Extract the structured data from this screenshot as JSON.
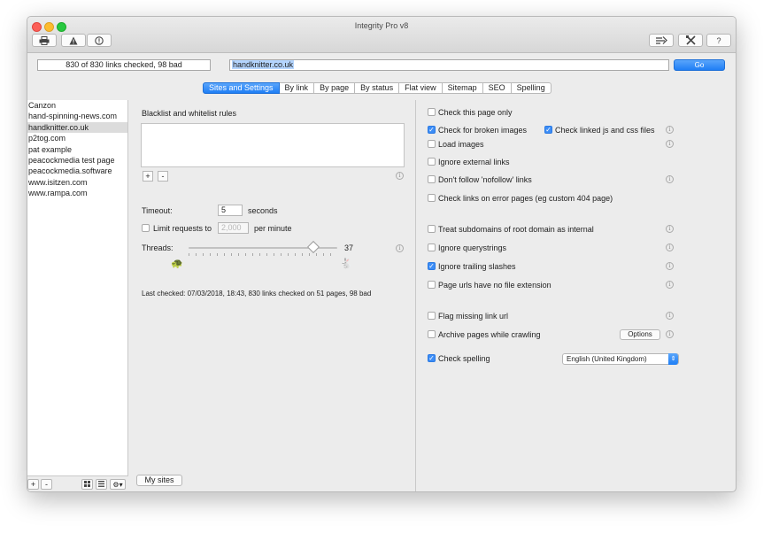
{
  "window": {
    "title": "Integrity Pro v8"
  },
  "toolbar": {
    "print_icon": "printer-icon",
    "warning_icon": "warning-icon",
    "info_icon": "info-icon",
    "filter_icon": "filter-icon",
    "tools_icon": "tools-icon",
    "help_label": "?"
  },
  "status": {
    "link_count": "830 of 830 links checked, 98 bad"
  },
  "url": {
    "value": "handknitter.co.uk",
    "go_label": "Go"
  },
  "tabs": [
    "Sites and Settings",
    "By link",
    "By page",
    "By status",
    "Flat view",
    "Sitemap",
    "SEO",
    "Spelling"
  ],
  "sidebar": {
    "sites": [
      "Canzon",
      "hand-spinning-news.com",
      "handknitter.co.uk",
      "p2tog.com",
      "pat example",
      "peacockmedia test page",
      "peacockmedia.software",
      "www.isitzen.com",
      "www.rampa.com"
    ],
    "selected_index": 2,
    "add_label": "+",
    "remove_label": "-",
    "my_sites_label": "My sites"
  },
  "left_panel": {
    "rules_heading": "Blacklist and whitelist rules",
    "rule_add": "+",
    "rule_remove": "-",
    "timeout_label": "Timeout:",
    "timeout_value": "5",
    "timeout_unit": "seconds",
    "limit_label": "Limit requests to",
    "limit_value": "2,000",
    "limit_unit": "per minute",
    "threads_label": "Threads:",
    "threads_value": "37",
    "threads_fraction": 0.84,
    "last_checked": "Last checked: 07/03/2018, 18:43, 830 links checked on 51 pages, 98 bad"
  },
  "options": {
    "check_this_page_only": {
      "label": "Check this page only",
      "checked": false
    },
    "check_broken_images": {
      "label": "Check for broken images",
      "checked": true
    },
    "check_linked_js_css": {
      "label": "Check linked js and css files",
      "checked": true
    },
    "load_images": {
      "label": "Load images",
      "checked": false
    },
    "ignore_external": {
      "label": "Ignore external links",
      "checked": false
    },
    "dont_follow_nofollow": {
      "label": "Don't follow 'nofollow' links",
      "checked": false
    },
    "check_error_pages": {
      "label": "Check links on error pages (eg custom 404 page)",
      "checked": false
    },
    "treat_subdomains": {
      "label": "Treat subdomains of root domain as internal",
      "checked": false
    },
    "ignore_querystrings": {
      "label": "Ignore querystrings",
      "checked": false
    },
    "ignore_trailing_slashes": {
      "label": "Ignore trailing slashes",
      "checked": true
    },
    "no_file_extension": {
      "label": "Page urls have no file extension",
      "checked": false
    },
    "flag_missing_link": {
      "label": "Flag missing link url",
      "checked": false
    },
    "archive_pages": {
      "label": "Archive pages while crawling",
      "checked": false
    },
    "options_button": "Options",
    "check_spelling": {
      "label": "Check spelling",
      "checked": true
    },
    "language": "English (United Kingdom)"
  }
}
